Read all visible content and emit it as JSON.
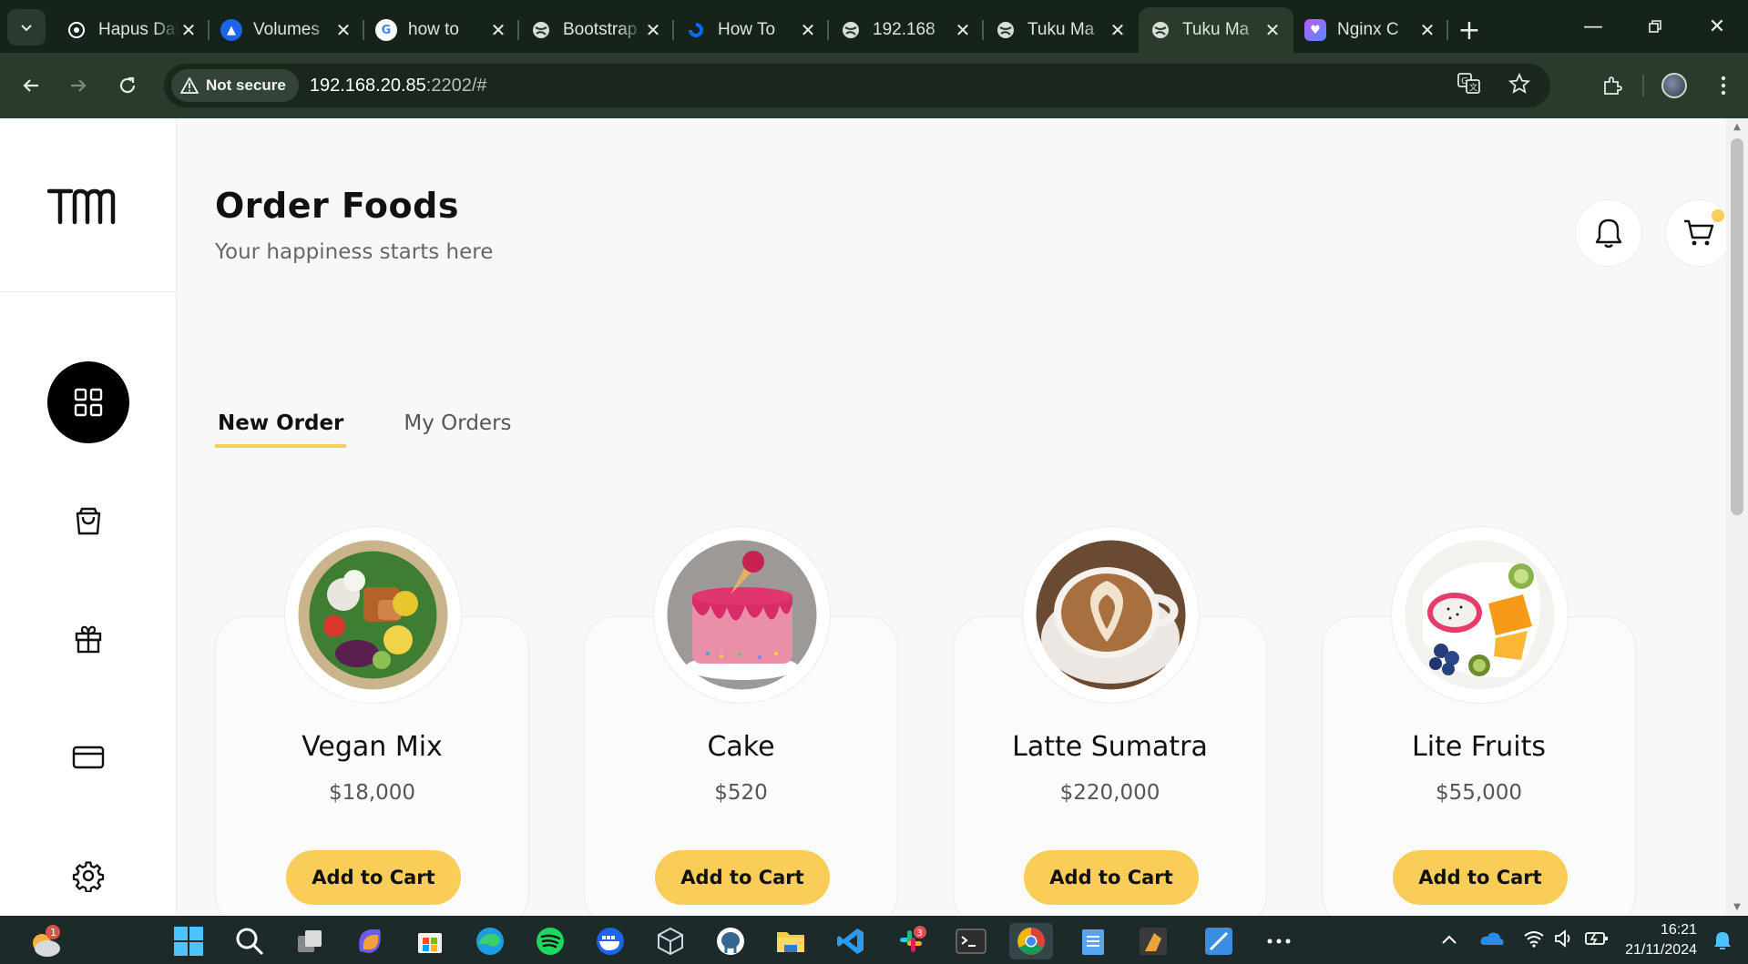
{
  "browser": {
    "tabs": [
      {
        "title": "Hapus Data",
        "icon": "openai-icon"
      },
      {
        "title": "Volumes",
        "icon": "docker-icon"
      },
      {
        "title": "how to",
        "icon": "google-icon"
      },
      {
        "title": "Bootstrap",
        "icon": "globe-icon"
      },
      {
        "title": "How To",
        "icon": "digitalocean-icon"
      },
      {
        "title": "192.168",
        "icon": "globe-icon"
      },
      {
        "title": "Tuku Ma",
        "icon": "globe-icon"
      },
      {
        "title": "Tuku Ma",
        "icon": "globe-icon",
        "active": true
      },
      {
        "title": "Nginx C",
        "icon": "nginx-ui-icon"
      }
    ],
    "security_label": "Not secure",
    "url_host": "192.168.20.85",
    "url_rest": ":2202/#"
  },
  "page": {
    "logo_text": "TM",
    "title": "Order Foods",
    "subtitle": "Your happiness starts here",
    "tabs": [
      {
        "label": "New Order",
        "active": true
      },
      {
        "label": "My Orders",
        "active": false
      }
    ],
    "sidebar": [
      {
        "name": "dashboard-grid-icon",
        "active": true
      },
      {
        "name": "shopping-bag-icon",
        "active": false
      },
      {
        "name": "gift-icon",
        "active": false
      },
      {
        "name": "credit-card-icon",
        "active": false
      },
      {
        "name": "settings-gear-icon",
        "active": false
      }
    ],
    "products": [
      {
        "name": "Vegan Mix",
        "price": "$18,000",
        "button": "Add to Cart"
      },
      {
        "name": "Cake",
        "price": "$520",
        "button": "Add to Cart"
      },
      {
        "name": "Latte Sumatra",
        "price": "$220,000",
        "button": "Add to Cart"
      },
      {
        "name": "Lite Fruits",
        "price": "$55,000",
        "button": "Add to Cart"
      }
    ],
    "accent_color": "#f9cd58"
  },
  "taskbar": {
    "time": "16:21",
    "date": "21/11/2024",
    "weather_badge": "1",
    "slack_badge": "3"
  }
}
